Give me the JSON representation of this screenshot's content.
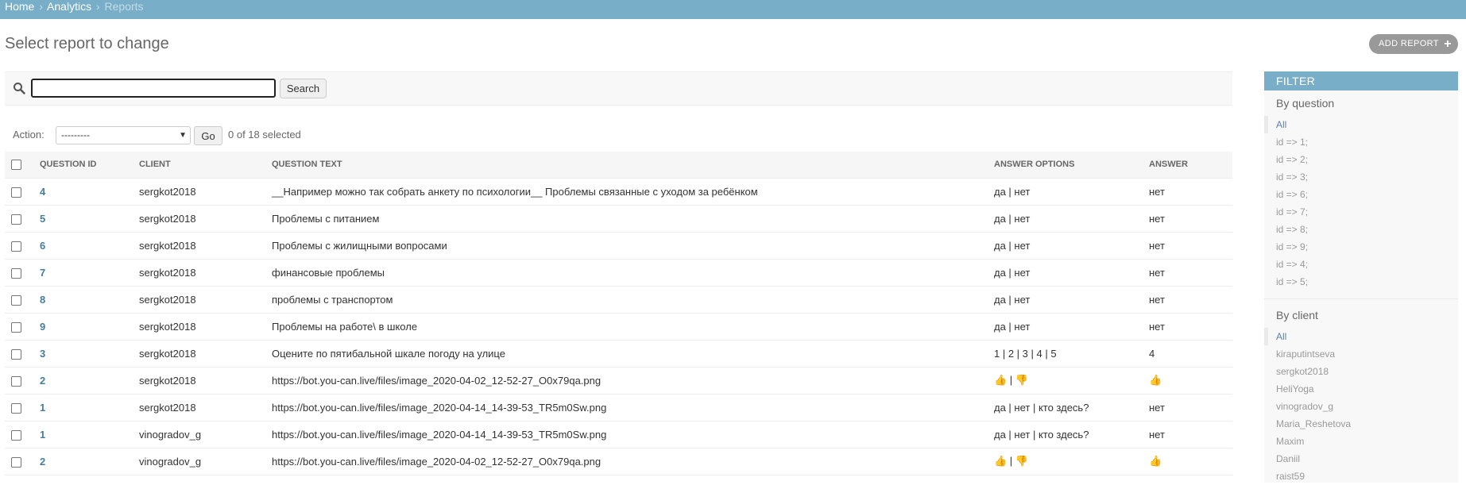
{
  "breadcrumbs": {
    "home": "Home",
    "app": "Analytics",
    "current": "Reports",
    "separator": "›"
  },
  "page": {
    "title": "Select report to change",
    "add_button": "ADD REPORT",
    "add_icon": "+"
  },
  "search": {
    "value": "",
    "button": "Search"
  },
  "actions": {
    "label": "Action:",
    "selected_option": "---------",
    "go": "Go",
    "counter": "0 of 18 selected"
  },
  "table": {
    "headers": [
      "QUESTION ID",
      "CLIENT",
      "QUESTION TEXT",
      "ANSWER OPTIONS",
      "ANSWER"
    ],
    "rows": [
      {
        "id": "4",
        "client": "sergkot2018",
        "text": "__Например можно так собрать анкету по психологии__ Проблемы связанные с уходом за ребёнком",
        "options": "да | нет",
        "answer": "нет"
      },
      {
        "id": "5",
        "client": "sergkot2018",
        "text": "Проблемы с питанием",
        "options": "да | нет",
        "answer": "нет"
      },
      {
        "id": "6",
        "client": "sergkot2018",
        "text": "Проблемы с жилищными вопросами",
        "options": "да | нет",
        "answer": "нет"
      },
      {
        "id": "7",
        "client": "sergkot2018",
        "text": "финансовые проблемы",
        "options": "да | нет",
        "answer": "нет"
      },
      {
        "id": "8",
        "client": "sergkot2018",
        "text": "проблемы с транспортом",
        "options": "да | нет",
        "answer": "нет"
      },
      {
        "id": "9",
        "client": "sergkot2018",
        "text": "Проблемы на работе\\ в школе",
        "options": "да | нет",
        "answer": "нет"
      },
      {
        "id": "3",
        "client": "sergkot2018",
        "text": "Оцените по пятибальной шкале погоду на улице",
        "options": "1 | 2 | 3 | 4 | 5",
        "answer": "4"
      },
      {
        "id": "2",
        "client": "sergkot2018",
        "text": "https://bot.you-can.live/files/image_2020-04-02_12-52-27_O0x79qa.png",
        "options": "👍 | 👎",
        "answer": "👍"
      },
      {
        "id": "1",
        "client": "sergkot2018",
        "text": "https://bot.you-can.live/files/image_2020-04-14_14-39-53_TR5m0Sw.png",
        "options": "да | нет | кто здесь?",
        "answer": "нет"
      },
      {
        "id": "1",
        "client": "vinogradov_g",
        "text": "https://bot.you-can.live/files/image_2020-04-14_14-39-53_TR5m0Sw.png",
        "options": "да | нет | кто здесь?",
        "answer": "нет"
      },
      {
        "id": "2",
        "client": "vinogradov_g",
        "text": "https://bot.you-can.live/files/image_2020-04-02_12-52-27_O0x79qa.png",
        "options": "👍 | 👎",
        "answer": "👍"
      }
    ]
  },
  "filter": {
    "title": "FILTER",
    "by_question": {
      "title": "By question",
      "items": [
        "All",
        "id => 1;",
        "id => 2;",
        "id => 3;",
        "id => 6;",
        "id => 7;",
        "id => 8;",
        "id => 9;",
        "id => 4;",
        "id => 5;"
      ]
    },
    "by_client": {
      "title": "By client",
      "items": [
        "All",
        "kiraputintseva",
        "sergkot2018",
        "HeliYoga",
        "vinogradov_g",
        "Maria_Reshetova",
        "Maxim",
        "Daniil",
        "raist59"
      ]
    }
  },
  "colors": {
    "header_blue": "#79aec8",
    "link_blue": "#447e9b",
    "filter_selected": "#5b80b2"
  }
}
